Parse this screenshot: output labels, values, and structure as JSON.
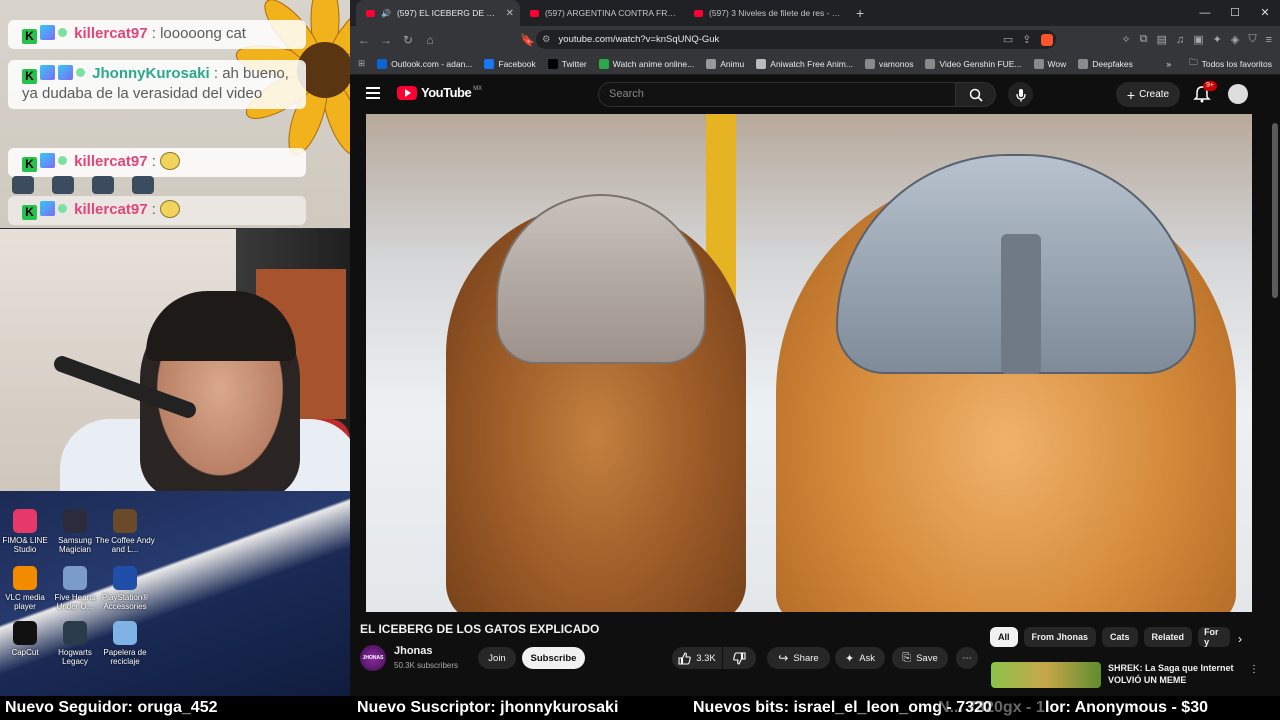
{
  "chat": {
    "messages": [
      {
        "user": "killercat97",
        "text": ": looooong cat"
      },
      {
        "user": "JhonnyKurosaki",
        "text": ": ah bueno, ya dudaba de la verasidad del video"
      },
      {
        "user": "killercat97",
        "text": ":"
      },
      {
        "user": "killercat97",
        "text": ":"
      }
    ]
  },
  "desktop": {
    "icons": [
      {
        "label": "FIMO& LINE Studio",
        "color": "#e6396a"
      },
      {
        "label": "Samsung Magician",
        "color": "#2b2b3b"
      },
      {
        "label": "The Coffee Andy and L...",
        "color": "#6b4a2a"
      },
      {
        "label": "VLC media player",
        "color": "#f28b00"
      },
      {
        "label": "Five Hearts Under O...",
        "color": "#7b9bc9"
      },
      {
        "label": "PlayStation® Accessories",
        "color": "#1f4fa8"
      },
      {
        "label": "CapCut",
        "color": "#111111"
      },
      {
        "label": "Hogwarts Legacy",
        "color": "#2a3b4a"
      },
      {
        "label": "Papelera de reciclaje",
        "color": "#7fb2e5"
      }
    ]
  },
  "browser": {
    "tabs": [
      {
        "title": "(597) EL ICEBERG DE LOS GAT",
        "active": true
      },
      {
        "title": "(597) ARGENTINA CONTRA FRANCIA",
        "active": false
      },
      {
        "title": "(597) 3 Niveles de filete de res - YouT",
        "active": false
      }
    ],
    "url": "youtube.com/watch?v=knSqUNQ-Guk",
    "bookmarks": [
      {
        "label": "Outlook.com - adan...",
        "color": "#0a64d8"
      },
      {
        "label": "Facebook",
        "color": "#1877f2"
      },
      {
        "label": "Twitter",
        "color": "#000000"
      },
      {
        "label": "Watch anime online...",
        "color": "#2ca84a"
      },
      {
        "label": "Animu",
        "color": "#999999"
      },
      {
        "label": "Aniwatch Free Anim...",
        "color": "#bbbbbb"
      },
      {
        "label": "vamonos",
        "color": "#8a8a8a"
      },
      {
        "label": "Video Genshin FUE...",
        "color": "#8a8a8a"
      },
      {
        "label": "Wow",
        "color": "#8a8a8a"
      },
      {
        "label": "Deepfakes",
        "color": "#8a8a8a"
      }
    ],
    "all_bookmarks": "Todos los favoritos"
  },
  "youtube": {
    "logo": "YouTube",
    "region": "MX",
    "search_placeholder": "Search",
    "create_label": "Create",
    "notifications": "9+",
    "video_title": "EL ICEBERG DE LOS GATOS EXPLICADO",
    "channel": {
      "name": "Jhonas",
      "subscribers": "50.3K subscribers",
      "avatar_text": "JHONAS"
    },
    "join_label": "Join",
    "subscribe_label": "Subscribe",
    "likes": "3.3K",
    "share_label": "Share",
    "ask_label": "Ask",
    "save_label": "Save",
    "chips": [
      "All",
      "From Jhonas",
      "Cats",
      "Related",
      "For y"
    ],
    "recommendation": {
      "title": "SHREK: La Saga que Internet VOLVIÓ UN MEME"
    }
  },
  "ticker": {
    "follower": "Nuevo Seguidor: oruga_452",
    "subscriber": "Nuevo Suscriptor: jhonnykurosaki",
    "bits": "Nuevos bits: israel_el_leon_omg - 7320",
    "bits_overlap": "N... 7320gx - 1",
    "donor": "lor: Anonymous - $30"
  }
}
